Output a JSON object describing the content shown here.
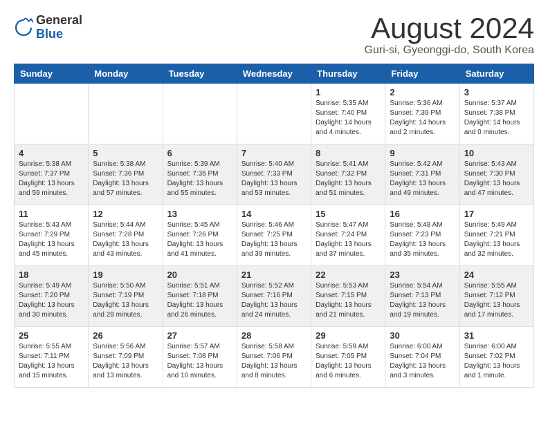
{
  "header": {
    "logo_general": "General",
    "logo_blue": "Blue",
    "month_title": "August 2024",
    "location": "Guri-si, Gyeonggi-do, South Korea"
  },
  "days_of_week": [
    "Sunday",
    "Monday",
    "Tuesday",
    "Wednesday",
    "Thursday",
    "Friday",
    "Saturday"
  ],
  "weeks": [
    [
      {
        "day": "",
        "info": ""
      },
      {
        "day": "",
        "info": ""
      },
      {
        "day": "",
        "info": ""
      },
      {
        "day": "",
        "info": ""
      },
      {
        "day": "1",
        "info": "Sunrise: 5:35 AM\nSunset: 7:40 PM\nDaylight: 14 hours\nand 4 minutes."
      },
      {
        "day": "2",
        "info": "Sunrise: 5:36 AM\nSunset: 7:39 PM\nDaylight: 14 hours\nand 2 minutes."
      },
      {
        "day": "3",
        "info": "Sunrise: 5:37 AM\nSunset: 7:38 PM\nDaylight: 14 hours\nand 0 minutes."
      }
    ],
    [
      {
        "day": "4",
        "info": "Sunrise: 5:38 AM\nSunset: 7:37 PM\nDaylight: 13 hours\nand 59 minutes."
      },
      {
        "day": "5",
        "info": "Sunrise: 5:38 AM\nSunset: 7:36 PM\nDaylight: 13 hours\nand 57 minutes."
      },
      {
        "day": "6",
        "info": "Sunrise: 5:39 AM\nSunset: 7:35 PM\nDaylight: 13 hours\nand 55 minutes."
      },
      {
        "day": "7",
        "info": "Sunrise: 5:40 AM\nSunset: 7:33 PM\nDaylight: 13 hours\nand 53 minutes."
      },
      {
        "day": "8",
        "info": "Sunrise: 5:41 AM\nSunset: 7:32 PM\nDaylight: 13 hours\nand 51 minutes."
      },
      {
        "day": "9",
        "info": "Sunrise: 5:42 AM\nSunset: 7:31 PM\nDaylight: 13 hours\nand 49 minutes."
      },
      {
        "day": "10",
        "info": "Sunrise: 5:43 AM\nSunset: 7:30 PM\nDaylight: 13 hours\nand 47 minutes."
      }
    ],
    [
      {
        "day": "11",
        "info": "Sunrise: 5:43 AM\nSunset: 7:29 PM\nDaylight: 13 hours\nand 45 minutes."
      },
      {
        "day": "12",
        "info": "Sunrise: 5:44 AM\nSunset: 7:28 PM\nDaylight: 13 hours\nand 43 minutes."
      },
      {
        "day": "13",
        "info": "Sunrise: 5:45 AM\nSunset: 7:26 PM\nDaylight: 13 hours\nand 41 minutes."
      },
      {
        "day": "14",
        "info": "Sunrise: 5:46 AM\nSunset: 7:25 PM\nDaylight: 13 hours\nand 39 minutes."
      },
      {
        "day": "15",
        "info": "Sunrise: 5:47 AM\nSunset: 7:24 PM\nDaylight: 13 hours\nand 37 minutes."
      },
      {
        "day": "16",
        "info": "Sunrise: 5:48 AM\nSunset: 7:23 PM\nDaylight: 13 hours\nand 35 minutes."
      },
      {
        "day": "17",
        "info": "Sunrise: 5:49 AM\nSunset: 7:21 PM\nDaylight: 13 hours\nand 32 minutes."
      }
    ],
    [
      {
        "day": "18",
        "info": "Sunrise: 5:49 AM\nSunset: 7:20 PM\nDaylight: 13 hours\nand 30 minutes."
      },
      {
        "day": "19",
        "info": "Sunrise: 5:50 AM\nSunset: 7:19 PM\nDaylight: 13 hours\nand 28 minutes."
      },
      {
        "day": "20",
        "info": "Sunrise: 5:51 AM\nSunset: 7:18 PM\nDaylight: 13 hours\nand 26 minutes."
      },
      {
        "day": "21",
        "info": "Sunrise: 5:52 AM\nSunset: 7:16 PM\nDaylight: 13 hours\nand 24 minutes."
      },
      {
        "day": "22",
        "info": "Sunrise: 5:53 AM\nSunset: 7:15 PM\nDaylight: 13 hours\nand 21 minutes."
      },
      {
        "day": "23",
        "info": "Sunrise: 5:54 AM\nSunset: 7:13 PM\nDaylight: 13 hours\nand 19 minutes."
      },
      {
        "day": "24",
        "info": "Sunrise: 5:55 AM\nSunset: 7:12 PM\nDaylight: 13 hours\nand 17 minutes."
      }
    ],
    [
      {
        "day": "25",
        "info": "Sunrise: 5:55 AM\nSunset: 7:11 PM\nDaylight: 13 hours\nand 15 minutes."
      },
      {
        "day": "26",
        "info": "Sunrise: 5:56 AM\nSunset: 7:09 PM\nDaylight: 13 hours\nand 13 minutes."
      },
      {
        "day": "27",
        "info": "Sunrise: 5:57 AM\nSunset: 7:08 PM\nDaylight: 13 hours\nand 10 minutes."
      },
      {
        "day": "28",
        "info": "Sunrise: 5:58 AM\nSunset: 7:06 PM\nDaylight: 13 hours\nand 8 minutes."
      },
      {
        "day": "29",
        "info": "Sunrise: 5:59 AM\nSunset: 7:05 PM\nDaylight: 13 hours\nand 6 minutes."
      },
      {
        "day": "30",
        "info": "Sunrise: 6:00 AM\nSunset: 7:04 PM\nDaylight: 13 hours\nand 3 minutes."
      },
      {
        "day": "31",
        "info": "Sunrise: 6:00 AM\nSunset: 7:02 PM\nDaylight: 13 hours\nand 1 minute."
      }
    ]
  ]
}
